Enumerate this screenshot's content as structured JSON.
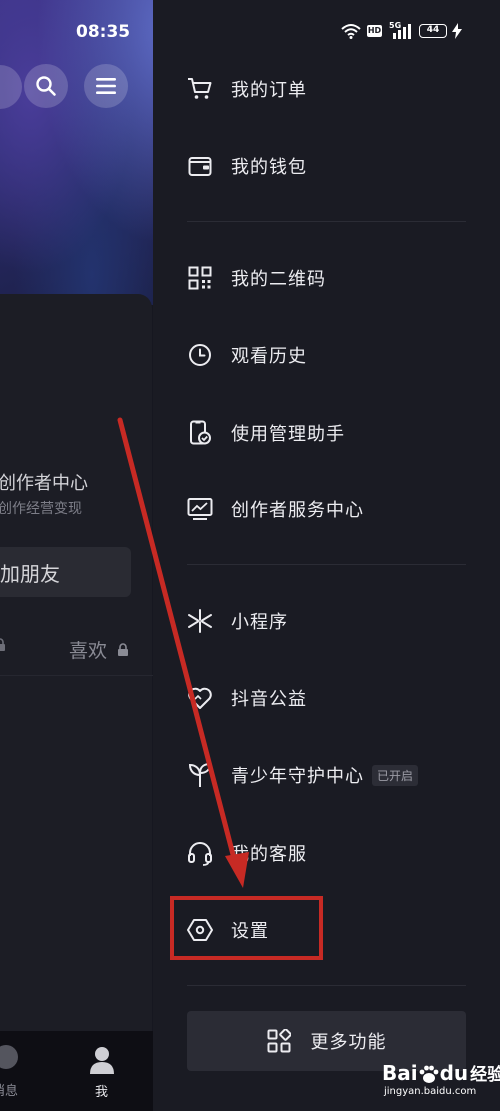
{
  "status_bar": {
    "time": "08:35",
    "network": "5G",
    "hd": "HD",
    "battery": "44"
  },
  "background_page": {
    "creator_center_title": "创作者中心",
    "creator_center_subtitle": "创作经营变现",
    "add_friend": "加朋友",
    "likes_tab": "喜欢",
    "nav_messages": "消息",
    "nav_me": "我"
  },
  "drawer": {
    "menu_items": [
      {
        "label": "我的订单",
        "icon": "cart-icon"
      },
      {
        "label": "我的钱包",
        "icon": "wallet-icon"
      },
      {
        "label": "我的二维码",
        "icon": "qr-code-icon"
      },
      {
        "label": "观看历史",
        "icon": "clock-icon"
      },
      {
        "label": "使用管理助手",
        "icon": "phone-check-icon"
      },
      {
        "label": "创作者服务中心",
        "icon": "monitor-chart-icon"
      },
      {
        "label": "小程序",
        "icon": "mini-program-icon"
      },
      {
        "label": "抖音公益",
        "icon": "heart-icon"
      },
      {
        "label": "青少年守护中心",
        "icon": "sprout-icon",
        "badge": "已开启"
      },
      {
        "label": "我的客服",
        "icon": "headset-icon"
      },
      {
        "label": "设置",
        "icon": "settings-hexagon-icon"
      }
    ],
    "more_button": "更多功能"
  },
  "watermark": {
    "brand": "Bai",
    "brand_suffix": "du",
    "product": "经验",
    "url": "jingyan.baidu.com"
  },
  "colors": {
    "drawer_bg": "#1a1b23",
    "highlight": "#c72a24",
    "text": "#ececf0"
  }
}
